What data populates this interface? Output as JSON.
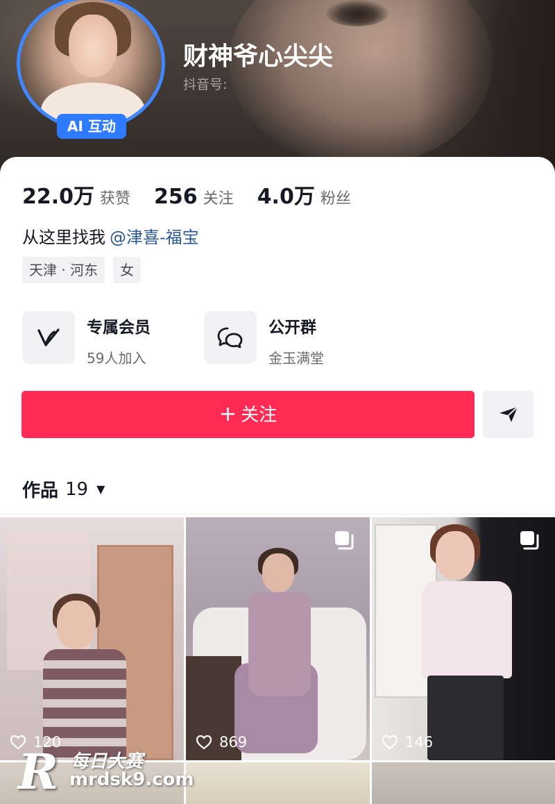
{
  "profile": {
    "name": "财神爷心尖尖",
    "douyin_id_label": "抖音号:",
    "ai_badge": "AI 互动"
  },
  "stats": [
    {
      "value": "22.0万",
      "label": "获赞"
    },
    {
      "value": "256",
      "label": "关注"
    },
    {
      "value": "4.0万",
      "label": "粉丝"
    }
  ],
  "bio": {
    "text": "从这里找我",
    "mention": "@津喜-福宝"
  },
  "tags": [
    "天津 · 河东",
    "女"
  ],
  "features": [
    {
      "title": "专属会员",
      "subtitle": "59人加入",
      "icon": "vip-v-icon"
    },
    {
      "title": "公开群",
      "subtitle": "金玉满堂",
      "icon": "chat-bubbles-icon"
    }
  ],
  "actions": {
    "follow_label": "关注",
    "follow_icon": "+",
    "share_icon": "send-arrow-icon"
  },
  "works": {
    "label": "作品",
    "count": "19"
  },
  "videos": [
    {
      "likes": "120",
      "multi_image": false
    },
    {
      "likes": "869",
      "multi_image": true
    },
    {
      "likes": "146",
      "multi_image": true
    }
  ],
  "watermark": {
    "logo": "R",
    "text_cn": "每日大赛",
    "url": "mrdsk9.com"
  },
  "colors": {
    "accent": "#fe2c55",
    "ai_badge": "#2f7bff",
    "mention": "#2b5897"
  }
}
